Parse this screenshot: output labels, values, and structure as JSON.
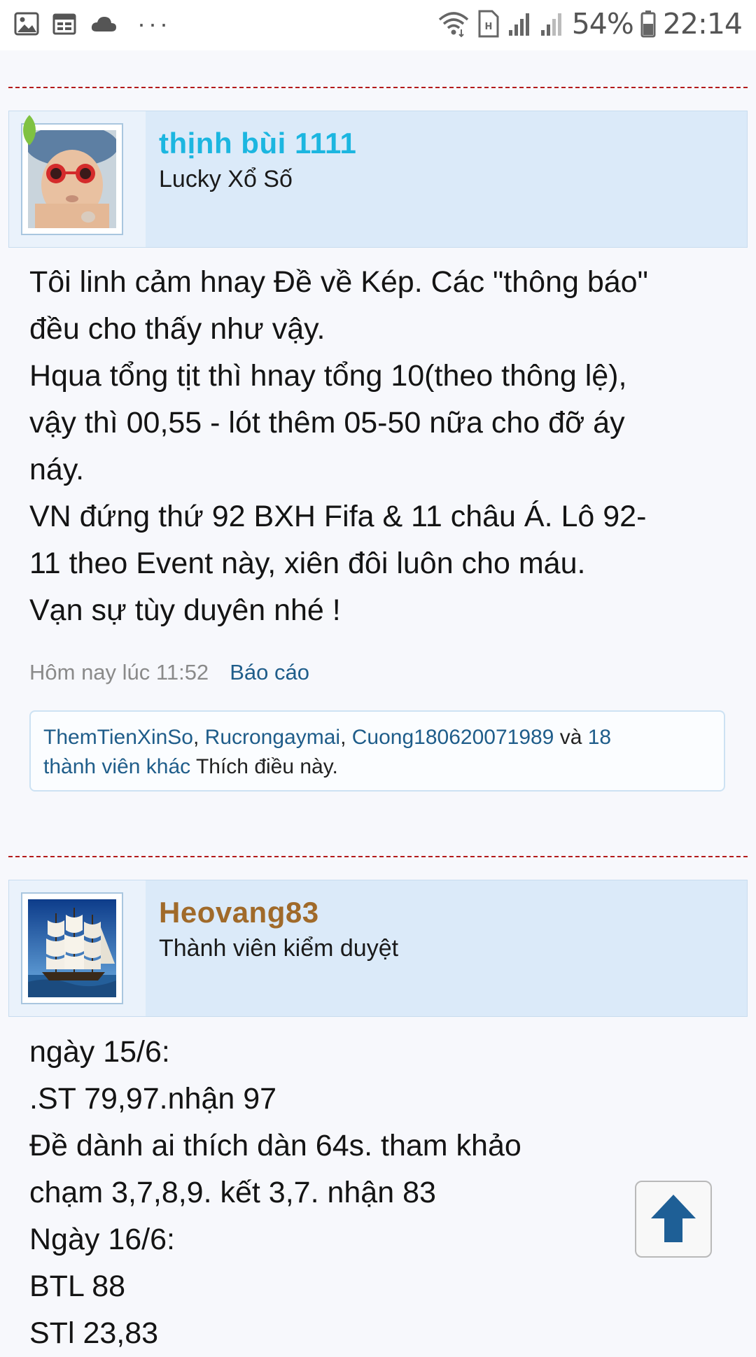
{
  "status_bar": {
    "battery": "54%",
    "time": "22:14",
    "left_icons": [
      "image-icon",
      "calendar-icon",
      "cloud-icon"
    ],
    "right_icons": [
      "wifi-icon",
      "sim-icon",
      "signal-1-icon",
      "signal-2-icon",
      "battery-icon"
    ]
  },
  "posts": [
    {
      "username": "thịnh bùi 1111",
      "username_color": "#1cb6e0",
      "user_title": "Lucky Xổ Số",
      "online": true,
      "body_lines": [
        "Tôi linh cảm hnay Đề về Kép. Các \"thông báo\"",
        "đều cho thấy như vậy.",
        "Hqua tổng tịt thì hnay tổng 10(theo thông lệ),",
        "vậy thì 00,55 - lót thêm 05-50 nữa cho đỡ áy",
        "náy.",
        "VN đứng thứ 92 BXH Fifa & 11 châu Á. Lô 92-",
        "11 theo Event này, xiên đôi luôn cho máu.",
        "Vạn sự tùy duyên nhé !"
      ],
      "timestamp": "Hôm nay lúc 11:52",
      "report_label": "Báo cáo",
      "likes": {
        "user1": "ThemTienXinSo",
        "sep1": ", ",
        "user2": "Rucrongaymai",
        "sep2": ", ",
        "user3": "Cuong180620071989",
        "and": " và ",
        "others_a": "18",
        "others_b": "thành viên khác",
        "suffix": " Thích điều này."
      }
    },
    {
      "username": "Heovang83",
      "username_color": "#a06a2a",
      "user_title": "Thành viên kiểm duyệt",
      "online": false,
      "body_lines": [
        "ngày 15/6:",
        ".ST 79,97.nhận 97",
        "Đề dành ai thích dàn 64s. tham khảo",
        "chạm 3,7,8,9. kết 3,7. nhận 83",
        "Ngày 16/6:",
        "BTL 88",
        "STl 23,83"
      ]
    }
  ],
  "scroll_top_icon": "arrow-up-icon"
}
